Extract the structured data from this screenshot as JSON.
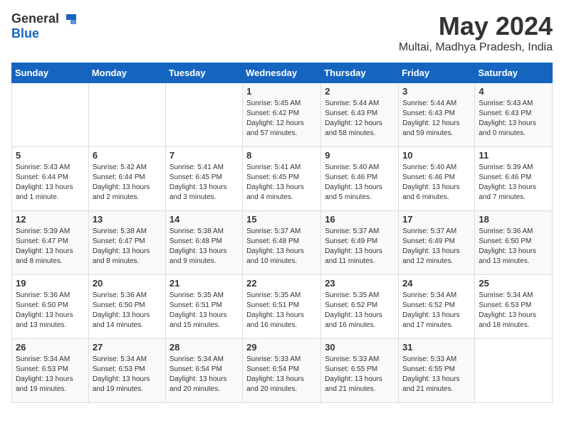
{
  "header": {
    "logo_general": "General",
    "logo_blue": "Blue",
    "month": "May 2024",
    "location": "Multai, Madhya Pradesh, India"
  },
  "days_of_week": [
    "Sunday",
    "Monday",
    "Tuesday",
    "Wednesday",
    "Thursday",
    "Friday",
    "Saturday"
  ],
  "weeks": [
    [
      {
        "day": "",
        "info": ""
      },
      {
        "day": "",
        "info": ""
      },
      {
        "day": "",
        "info": ""
      },
      {
        "day": "1",
        "info": "Sunrise: 5:45 AM\nSunset: 6:42 PM\nDaylight: 12 hours\nand 57 minutes."
      },
      {
        "day": "2",
        "info": "Sunrise: 5:44 AM\nSunset: 6:43 PM\nDaylight: 12 hours\nand 58 minutes."
      },
      {
        "day": "3",
        "info": "Sunrise: 5:44 AM\nSunset: 6:43 PM\nDaylight: 12 hours\nand 59 minutes."
      },
      {
        "day": "4",
        "info": "Sunrise: 5:43 AM\nSunset: 6:43 PM\nDaylight: 13 hours\nand 0 minutes."
      }
    ],
    [
      {
        "day": "5",
        "info": "Sunrise: 5:43 AM\nSunset: 6:44 PM\nDaylight: 13 hours\nand 1 minute."
      },
      {
        "day": "6",
        "info": "Sunrise: 5:42 AM\nSunset: 6:44 PM\nDaylight: 13 hours\nand 2 minutes."
      },
      {
        "day": "7",
        "info": "Sunrise: 5:41 AM\nSunset: 6:45 PM\nDaylight: 13 hours\nand 3 minutes."
      },
      {
        "day": "8",
        "info": "Sunrise: 5:41 AM\nSunset: 6:45 PM\nDaylight: 13 hours\nand 4 minutes."
      },
      {
        "day": "9",
        "info": "Sunrise: 5:40 AM\nSunset: 6:46 PM\nDaylight: 13 hours\nand 5 minutes."
      },
      {
        "day": "10",
        "info": "Sunrise: 5:40 AM\nSunset: 6:46 PM\nDaylight: 13 hours\nand 6 minutes."
      },
      {
        "day": "11",
        "info": "Sunrise: 5:39 AM\nSunset: 6:46 PM\nDaylight: 13 hours\nand 7 minutes."
      }
    ],
    [
      {
        "day": "12",
        "info": "Sunrise: 5:39 AM\nSunset: 6:47 PM\nDaylight: 13 hours\nand 8 minutes."
      },
      {
        "day": "13",
        "info": "Sunrise: 5:38 AM\nSunset: 6:47 PM\nDaylight: 13 hours\nand 8 minutes."
      },
      {
        "day": "14",
        "info": "Sunrise: 5:38 AM\nSunset: 6:48 PM\nDaylight: 13 hours\nand 9 minutes."
      },
      {
        "day": "15",
        "info": "Sunrise: 5:37 AM\nSunset: 6:48 PM\nDaylight: 13 hours\nand 10 minutes."
      },
      {
        "day": "16",
        "info": "Sunrise: 5:37 AM\nSunset: 6:49 PM\nDaylight: 13 hours\nand 11 minutes."
      },
      {
        "day": "17",
        "info": "Sunrise: 5:37 AM\nSunset: 6:49 PM\nDaylight: 13 hours\nand 12 minutes."
      },
      {
        "day": "18",
        "info": "Sunrise: 5:36 AM\nSunset: 6:50 PM\nDaylight: 13 hours\nand 13 minutes."
      }
    ],
    [
      {
        "day": "19",
        "info": "Sunrise: 5:36 AM\nSunset: 6:50 PM\nDaylight: 13 hours\nand 13 minutes."
      },
      {
        "day": "20",
        "info": "Sunrise: 5:36 AM\nSunset: 6:50 PM\nDaylight: 13 hours\nand 14 minutes."
      },
      {
        "day": "21",
        "info": "Sunrise: 5:35 AM\nSunset: 6:51 PM\nDaylight: 13 hours\nand 15 minutes."
      },
      {
        "day": "22",
        "info": "Sunrise: 5:35 AM\nSunset: 6:51 PM\nDaylight: 13 hours\nand 16 minutes."
      },
      {
        "day": "23",
        "info": "Sunrise: 5:35 AM\nSunset: 6:52 PM\nDaylight: 13 hours\nand 16 minutes."
      },
      {
        "day": "24",
        "info": "Sunrise: 5:34 AM\nSunset: 6:52 PM\nDaylight: 13 hours\nand 17 minutes."
      },
      {
        "day": "25",
        "info": "Sunrise: 5:34 AM\nSunset: 6:53 PM\nDaylight: 13 hours\nand 18 minutes."
      }
    ],
    [
      {
        "day": "26",
        "info": "Sunrise: 5:34 AM\nSunset: 6:53 PM\nDaylight: 13 hours\nand 19 minutes."
      },
      {
        "day": "27",
        "info": "Sunrise: 5:34 AM\nSunset: 6:53 PM\nDaylight: 13 hours\nand 19 minutes."
      },
      {
        "day": "28",
        "info": "Sunrise: 5:34 AM\nSunset: 6:54 PM\nDaylight: 13 hours\nand 20 minutes."
      },
      {
        "day": "29",
        "info": "Sunrise: 5:33 AM\nSunset: 6:54 PM\nDaylight: 13 hours\nand 20 minutes."
      },
      {
        "day": "30",
        "info": "Sunrise: 5:33 AM\nSunset: 6:55 PM\nDaylight: 13 hours\nand 21 minutes."
      },
      {
        "day": "31",
        "info": "Sunrise: 5:33 AM\nSunset: 6:55 PM\nDaylight: 13 hours\nand 21 minutes."
      },
      {
        "day": "",
        "info": ""
      }
    ]
  ]
}
